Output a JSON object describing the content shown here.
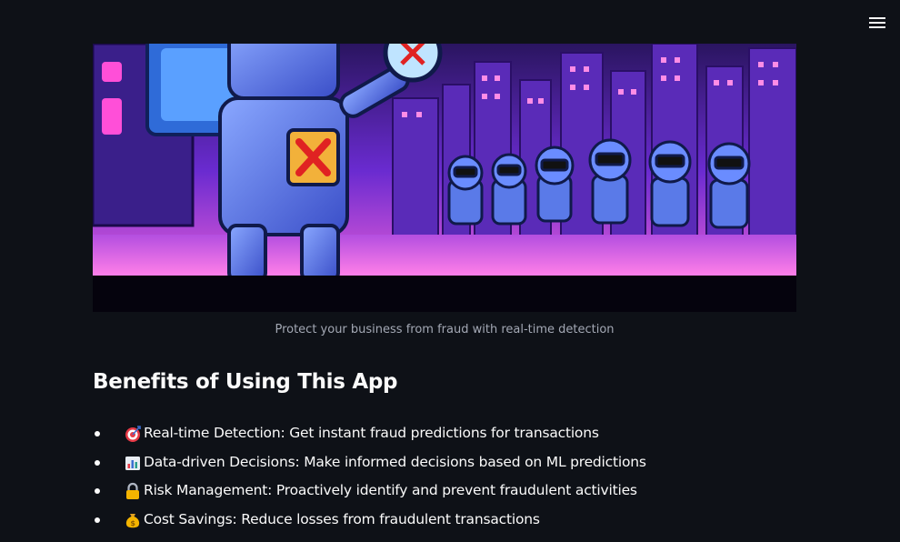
{
  "header": {
    "menu_icon": "hamburger-menu-icon"
  },
  "hero": {
    "image_subject": "robot-fraud-detector-city-illustration",
    "caption": "Protect your business from fraud with real-time detection"
  },
  "benefits_section": {
    "title": "Benefits of Using This App",
    "items": [
      {
        "icon": "target-icon",
        "text": "Real-time Detection: Get instant fraud predictions for transactions"
      },
      {
        "icon": "bar-chart-icon",
        "text": "Data-driven Decisions: Make informed decisions based on ML predictions"
      },
      {
        "icon": "lock-icon",
        "text": "Risk Management: Proactively identify and prevent fraudulent activities"
      },
      {
        "icon": "money-bag-icon",
        "text": "Cost Savings: Reduce losses from fraudulent transactions"
      }
    ]
  },
  "colors": {
    "background": "#0e1117",
    "text": "#fafafa",
    "caption": "#a3a8b4",
    "hero_purple": "#7b3fe0",
    "hero_pink": "#ff4fd8",
    "warning_x": "#e02222"
  }
}
